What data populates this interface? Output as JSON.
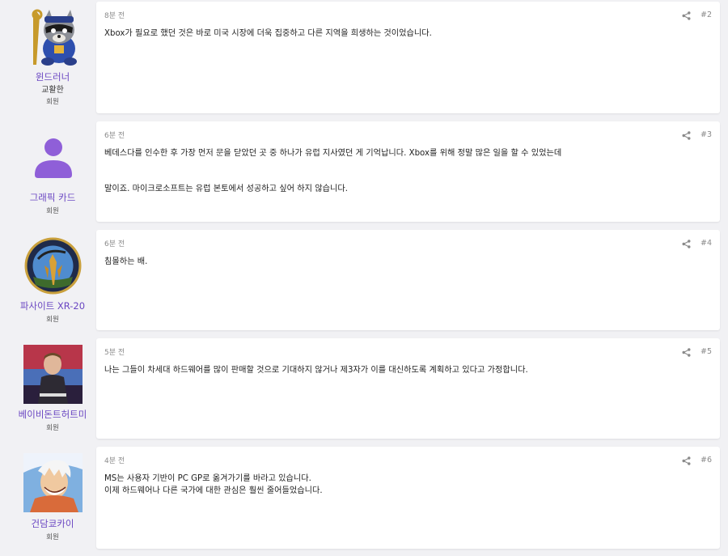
{
  "posts": [
    {
      "user": {
        "name": "윈드러너",
        "title": "교활한",
        "role": "회원",
        "avatar": "plush-raccoon-avatar"
      },
      "time": "8분 전",
      "number": "#2",
      "lines": [
        "Xbox가 필요로 했던 것은 바로 미국 시장에 더욱 집중하고 다른 지역을 희생하는 것이었습니다."
      ]
    },
    {
      "user": {
        "name": "그래픽 카드",
        "title": "",
        "role": "회원",
        "avatar": "default-person-avatar"
      },
      "time": "6분 전",
      "number": "#3",
      "lines": [
        "베데스다를 인수한 후 가장 먼저 문을 닫았던 곳 중 하나가 유럽 지사였던 게 기억납니다. Xbox를 위해 정말 많은 일을 할 수 있었는데",
        "",
        "",
        "말이죠. 마이크로소프트는 유럽 본토에서 성공하고 싶어 하지 않습니다."
      ]
    },
    {
      "user": {
        "name": "파사이트 XR-20",
        "title": "",
        "role": "회원",
        "avatar": "mission-patch-avatar"
      },
      "time": "6분 전",
      "number": "#4",
      "lines": [
        "침몰하는 배."
      ]
    },
    {
      "user": {
        "name": "베이비돈트허트미",
        "title": "",
        "role": "회원",
        "avatar": "superman-poster-avatar"
      },
      "time": "5분 전",
      "number": "#5",
      "lines": [
        "나는 그들이 차세대 하드웨어를 많이 판매할 것으로 기대하지 않거나 제3자가 이를 대신하도록 계획하고 있다고 가정합니다."
      ]
    },
    {
      "user": {
        "name": "건담쿄카이",
        "title": "",
        "role": "회원",
        "avatar": "anime-character-avatar"
      },
      "time": "4분 전",
      "number": "#6",
      "lines": [
        "MS는 사용자 기반이 PC GP로 옮겨가기를 바라고 있습니다.",
        "이제 하드웨어나 다른 국가에 대한 관심은 훨씬 줄어들었습니다."
      ]
    }
  ],
  "share_icon": "share-icon",
  "colors": {
    "username": "#6a46c2",
    "background": "#f1f1f4",
    "card": "#ffffff",
    "meta": "#8a8a8a"
  }
}
